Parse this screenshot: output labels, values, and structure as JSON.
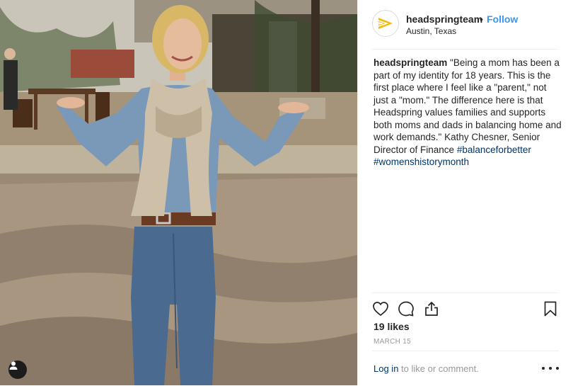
{
  "post": {
    "username": "headspringteam",
    "separator": "•",
    "follow_label": "Follow",
    "location": "Austin, Texas",
    "caption_user": "headspringteam",
    "caption_text": "\"Being a mom has been a part of my identity for 18 years. This is the first place where I feel like a \"parent,\" not just a \"mom.\" The difference here is that Headspring values families and supports both moms and dads in balancing home and work demands.\" Kathy Chesner, Senior Director of Finance",
    "hashtag_1": "#balanceforbetter",
    "hashtag_2": "#womenshistorymonth",
    "likes": "19 likes",
    "date": "MARCH 15",
    "login_link": "Log in",
    "login_rest": " to like or comment."
  },
  "icons": {
    "avatar": "headspring-logo-icon",
    "like": "heart-icon",
    "comment": "comment-icon",
    "share": "share-icon",
    "save": "bookmark-icon",
    "more": "more-options-icon",
    "tag": "user-tag-icon"
  },
  "colors": {
    "link_blue": "#3897f0",
    "hashtag_blue": "#003569",
    "logo_yellow": "#f5b800",
    "muted_gray": "#999999"
  }
}
